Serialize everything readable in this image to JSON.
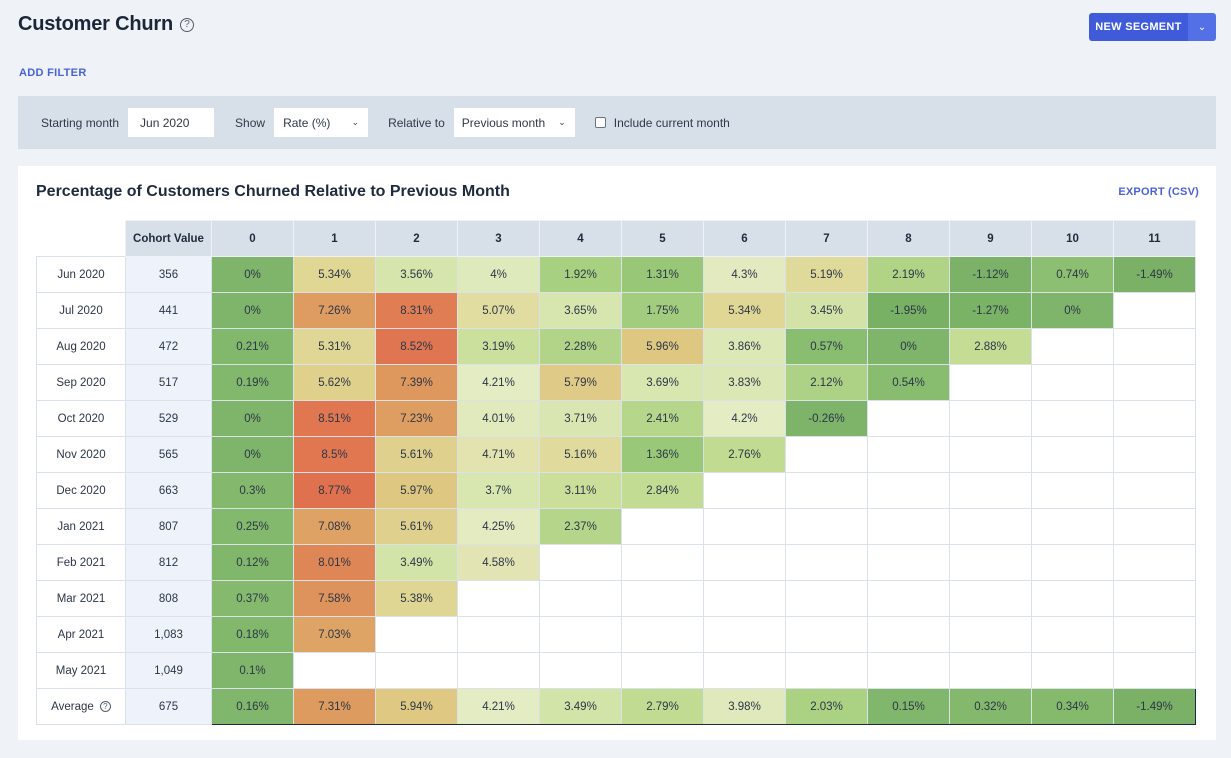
{
  "header": {
    "title": "Customer Churn",
    "help_icon": "question-circle-icon",
    "new_segment_label": "NEW SEGMENT",
    "dropdown_icon": "chevron-down-icon",
    "add_filter_label": "ADD FILTER"
  },
  "filters": {
    "starting_month_label": "Starting month",
    "starting_month_value": "Jun 2020",
    "show_label": "Show",
    "show_value": "Rate (%)",
    "relative_to_label": "Relative to",
    "relative_to_value": "Previous month",
    "include_current_label": "Include current month",
    "include_current_checked": false
  },
  "card": {
    "title": "Percentage of Customers Churned Relative to Previous Month",
    "export_label": "EXPORT (CSV)"
  },
  "colors": {
    "low": "#78b064",
    "mid": "#e4ecc3",
    "high_mid": "#dfc987",
    "high": "#e0714f",
    "accent": "#3f5bd9"
  },
  "chart_data": {
    "type": "heatmap",
    "title": "Percentage of Customers Churned Relative to Previous Month",
    "cohort_value_header": "Cohort Value",
    "columns": [
      "0",
      "1",
      "2",
      "3",
      "4",
      "5",
      "6",
      "7",
      "8",
      "9",
      "10",
      "11"
    ],
    "rows": [
      {
        "label": "Jun 2020",
        "cohort_value": "356",
        "values": [
          "0%",
          "5.34%",
          "3.56%",
          "4%",
          "1.92%",
          "1.31%",
          "4.3%",
          "5.19%",
          "2.19%",
          "-1.12%",
          "0.74%",
          "-1.49%"
        ]
      },
      {
        "label": "Jul 2020",
        "cohort_value": "441",
        "values": [
          "0%",
          "7.26%",
          "8.31%",
          "5.07%",
          "3.65%",
          "1.75%",
          "5.34%",
          "3.45%",
          "-1.95%",
          "-1.27%",
          "0%"
        ]
      },
      {
        "label": "Aug 2020",
        "cohort_value": "472",
        "values": [
          "0.21%",
          "5.31%",
          "8.52%",
          "3.19%",
          "2.28%",
          "5.96%",
          "3.86%",
          "0.57%",
          "0%",
          "2.88%"
        ]
      },
      {
        "label": "Sep 2020",
        "cohort_value": "517",
        "values": [
          "0.19%",
          "5.62%",
          "7.39%",
          "4.21%",
          "5.79%",
          "3.69%",
          "3.83%",
          "2.12%",
          "0.54%"
        ]
      },
      {
        "label": "Oct 2020",
        "cohort_value": "529",
        "values": [
          "0%",
          "8.51%",
          "7.23%",
          "4.01%",
          "3.71%",
          "2.41%",
          "4.2%",
          "-0.26%"
        ]
      },
      {
        "label": "Nov 2020",
        "cohort_value": "565",
        "values": [
          "0%",
          "8.5%",
          "5.61%",
          "4.71%",
          "5.16%",
          "1.36%",
          "2.76%"
        ]
      },
      {
        "label": "Dec 2020",
        "cohort_value": "663",
        "values": [
          "0.3%",
          "8.77%",
          "5.97%",
          "3.7%",
          "3.11%",
          "2.84%"
        ]
      },
      {
        "label": "Jan 2021",
        "cohort_value": "807",
        "values": [
          "0.25%",
          "7.08%",
          "5.61%",
          "4.25%",
          "2.37%"
        ]
      },
      {
        "label": "Feb 2021",
        "cohort_value": "812",
        "values": [
          "0.12%",
          "8.01%",
          "3.49%",
          "4.58%"
        ]
      },
      {
        "label": "Mar 2021",
        "cohort_value": "808",
        "values": [
          "0.37%",
          "7.58%",
          "5.38%"
        ]
      },
      {
        "label": "Apr 2021",
        "cohort_value": "1,083",
        "values": [
          "0.18%",
          "7.03%"
        ]
      },
      {
        "label": "May 2021",
        "cohort_value": "1,049",
        "values": [
          "0.1%"
        ]
      }
    ],
    "average": {
      "label": "Average",
      "cohort_value": "675",
      "values": [
        "0.16%",
        "7.31%",
        "5.94%",
        "4.21%",
        "3.49%",
        "2.79%",
        "3.98%",
        "2.03%",
        "0.15%",
        "0.32%",
        "0.34%",
        "-1.49%"
      ]
    },
    "color_scale": {
      "min": -2,
      "max": 9,
      "direction": "green-low-red-high"
    }
  }
}
